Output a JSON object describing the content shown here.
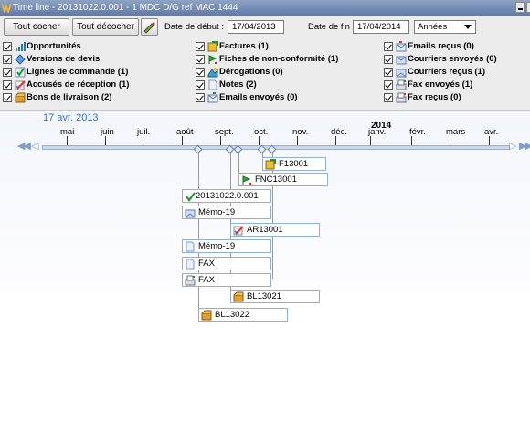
{
  "window": {
    "title": "Time line - 20131022.0.001 - 1 MDC D/G ref MAC 1444"
  },
  "toolbar": {
    "check_all": "Tout cocher",
    "uncheck_all": "Tout décocher",
    "start_label": "Date de début :",
    "start_value": "17/04/2013",
    "end_label": "Date de fin :",
    "end_value": "17/04/2014",
    "scale_value": "Années"
  },
  "filters": [
    {
      "label": "Opportunités",
      "icon": "bar-chart-icon"
    },
    {
      "label": "Versions de devis",
      "icon": "quote-version-icon"
    },
    {
      "label": "Lignes de commande (1)",
      "icon": "order-line-icon"
    },
    {
      "label": "Accusés de réception (1)",
      "icon": "receipt-ack-icon"
    },
    {
      "label": "Bons de livraison (2)",
      "icon": "delivery-box-icon"
    },
    {
      "label": "Factures (1)",
      "icon": "invoice-icon"
    },
    {
      "label": "Fiches de non-conformité (1)",
      "icon": "nonconformity-flag-icon"
    },
    {
      "label": "Dérogations (0)",
      "icon": "derogation-icon"
    },
    {
      "label": "Notes (2)",
      "icon": "note-icon"
    },
    {
      "label": "Emails envoyés (0)",
      "icon": "email-sent-icon"
    },
    {
      "label": "Emails reçus (0)",
      "icon": "email-received-icon"
    },
    {
      "label": "Courriers envoyés (0)",
      "icon": "mail-sent-icon"
    },
    {
      "label": "Courriers reçus (1)",
      "icon": "mail-received-icon"
    },
    {
      "label": "Fax envoyés (1)",
      "icon": "fax-sent-icon"
    },
    {
      "label": "Fax reçus (0)",
      "icon": "fax-received-icon"
    }
  ],
  "timeline": {
    "start_date": "17 avr. 2013",
    "year_label": "2014",
    "months": [
      "mai",
      "juin",
      "juil.",
      "août",
      "sept.",
      "oct.",
      "nov.",
      "déc.",
      "janv.",
      "févr.",
      "mars",
      "avr."
    ],
    "events": [
      {
        "label": "F13001",
        "icon": "invoice-icon"
      },
      {
        "label": "FNC13001",
        "icon": "nonconformity-flag-icon"
      },
      {
        "label": "20131022.0.001",
        "icon": "order-line-icon"
      },
      {
        "label": "Mémo-19",
        "icon": "mail-received-icon"
      },
      {
        "label": "AR13001",
        "icon": "receipt-ack-icon"
      },
      {
        "label": "Mémo-19",
        "icon": "note-icon"
      },
      {
        "label": "FAX",
        "icon": "note-icon"
      },
      {
        "label": "FAX",
        "icon": "fax-sent-icon"
      },
      {
        "label": "BL13021",
        "icon": "delivery-box-icon"
      },
      {
        "label": "BL13022",
        "icon": "delivery-box-icon"
      }
    ]
  },
  "colors": {
    "accent": "#3a6fb8",
    "scale_fill": "#c9daf0",
    "titlebar": "#6f89b3"
  }
}
